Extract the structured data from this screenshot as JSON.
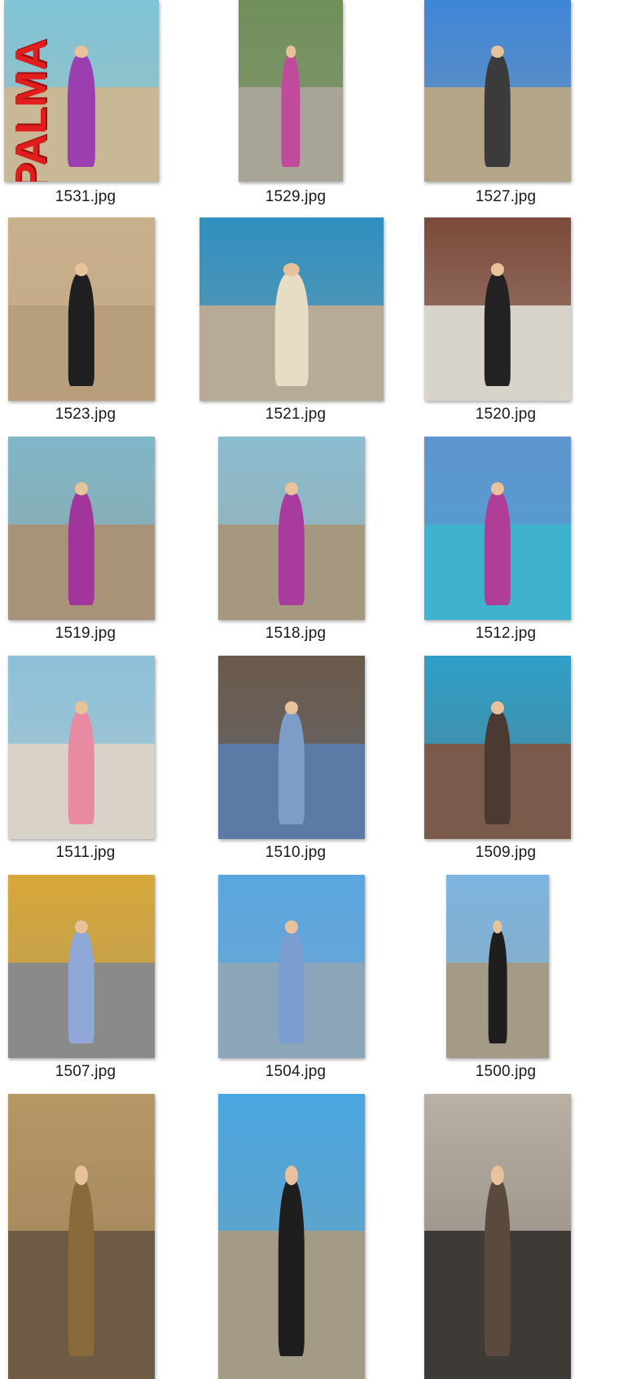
{
  "files": [
    {
      "name": "1531.jpg",
      "sky": "#7fc4d8",
      "ground": "#c9b896",
      "dress": "#9b3fb0",
      "overlay": "PALMA"
    },
    {
      "name": "1529.jpg",
      "sky": "#6f8f5a",
      "ground": "#a8a496",
      "dress": "#c04a9c"
    },
    {
      "name": "1527.jpg",
      "sky": "#3f86d8",
      "ground": "#b4a58a",
      "dress": "#3b3b3b"
    },
    {
      "name": "1523.jpg",
      "sky": "#c9b08c",
      "ground": "#b89f7c",
      "dress": "#1f1f1f"
    },
    {
      "name": "1521.jpg",
      "sky": "#2f8fc0",
      "ground": "#b7ab98",
      "dress": "#e8dcc4"
    },
    {
      "name": "1520.jpg",
      "sky": "#7a4a3a",
      "ground": "#d8d4cc",
      "dress": "#222222"
    },
    {
      "name": "1519.jpg",
      "sky": "#7fb6c8",
      "ground": "#a89278",
      "dress": "#a2359c"
    },
    {
      "name": "1518.jpg",
      "sky": "#8cbcd0",
      "ground": "#a6987e",
      "dress": "#a93b9f"
    },
    {
      "name": "1512.jpg",
      "sky": "#5e95cf",
      "ground": "#3fb2cf",
      "dress": "#b03e98"
    },
    {
      "name": "1511.jpg",
      "sky": "#8cc0d8",
      "ground": "#d8d2c8",
      "dress": "#e88aa2"
    },
    {
      "name": "1510.jpg",
      "sky": "#6b5a4a",
      "ground": "#5c7aa6",
      "dress": "#7d9cc8"
    },
    {
      "name": "1509.jpg",
      "sky": "#2f9fc8",
      "ground": "#7a5a4a",
      "dress": "#4a3a32"
    },
    {
      "name": "1507.jpg",
      "sky": "#d7a83a",
      "ground": "#8a8a88",
      "dress": "#8fa8d8"
    },
    {
      "name": "1504.jpg",
      "sky": "#5aa6e0",
      "ground": "#8aa6b8",
      "dress": "#7a9ed0"
    },
    {
      "name": "1500.jpg",
      "sky": "#7cb4e0",
      "ground": "#a39b86",
      "dress": "#1e1e1e"
    },
    {
      "name": "",
      "sky": "#b69766",
      "ground": "#6e5c44",
      "dress": "#8a6a3a"
    },
    {
      "name": "",
      "sky": "#4aa6e0",
      "ground": "#a39b86",
      "dress": "#1e1e1e"
    },
    {
      "name": "",
      "sky": "#b9b0a4",
      "ground": "#3e3a36",
      "dress": "#5a4a3e"
    }
  ]
}
